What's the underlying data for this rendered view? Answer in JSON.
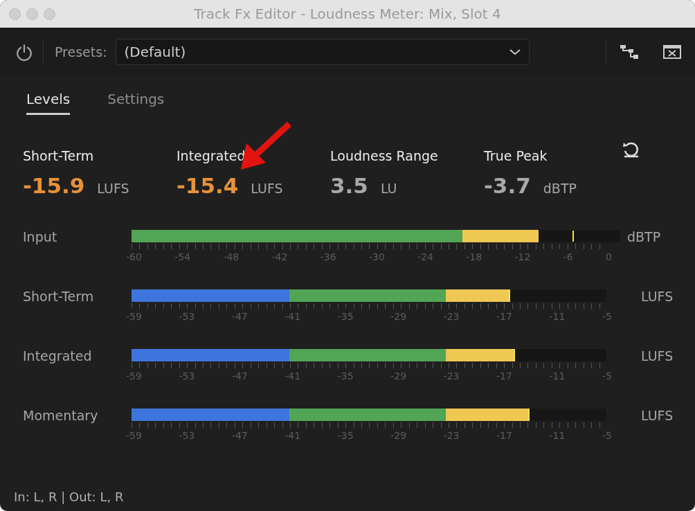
{
  "window": {
    "title": "Track Fx Editor - Loudness Meter: Mix, Slot 4"
  },
  "toolbar": {
    "presets_label": "Presets:",
    "preset_value": "(Default)"
  },
  "tabs": [
    {
      "label": "Levels",
      "selected": true
    },
    {
      "label": "Settings",
      "selected": false
    }
  ],
  "stats": [
    {
      "label": "Short-Term",
      "value": "-15.9",
      "unit": "LUFS",
      "color": "#e8913a"
    },
    {
      "label": "Integrated",
      "value": "-15.4",
      "unit": "LUFS",
      "color": "#e8913a"
    },
    {
      "label": "Loudness Range",
      "value": "3.5",
      "unit": "LU",
      "color": "#a8a8a8"
    },
    {
      "label": "True Peak",
      "value": "-3.7",
      "unit": "dBTP",
      "color": "#a8a8a8"
    }
  ],
  "meters": [
    {
      "label": "Input",
      "kind": "true-peak",
      "level": 0.833,
      "peak": {
        "level": 0.902
      },
      "unit": "dBTP",
      "scale": [
        "-60",
        "-54",
        "-48",
        "-42",
        "-36",
        "-30",
        "-24",
        "-18",
        "-12",
        "-6",
        "0"
      ]
    },
    {
      "label": "Short-Term",
      "kind": "loudness",
      "level": 0.797,
      "unit": "LUFS",
      "scale": [
        "-59",
        "-53",
        "-47",
        "-41",
        "-35",
        "-29",
        "-23",
        "-17",
        "-11",
        "-5"
      ]
    },
    {
      "label": "Integrated",
      "kind": "loudness",
      "level": 0.808,
      "unit": "LUFS",
      "scale": [
        "-59",
        "-53",
        "-47",
        "-41",
        "-35",
        "-29",
        "-23",
        "-17",
        "-11",
        "-5"
      ]
    },
    {
      "label": "Momentary",
      "kind": "loudness",
      "level": 0.838,
      "unit": "LUFS",
      "scale": [
        "-59",
        "-53",
        "-47",
        "-41",
        "-35",
        "-29",
        "-23",
        "-17",
        "-11",
        "-5"
      ]
    }
  ],
  "status_bar": {
    "text": "In: L, R | Out: L, R"
  }
}
